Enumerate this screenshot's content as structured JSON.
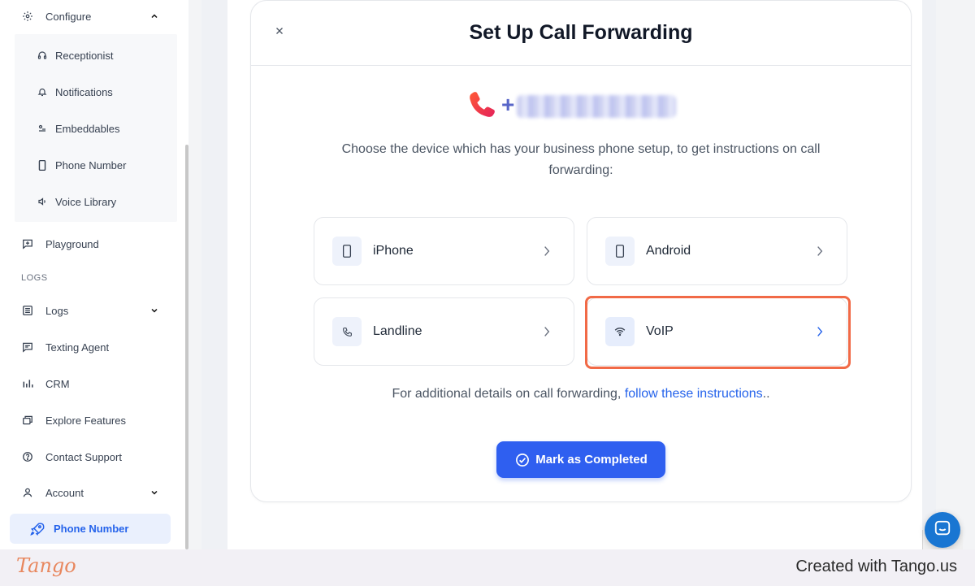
{
  "sidebar": {
    "configure_label": "Configure",
    "submenu": [
      {
        "label": "Receptionist",
        "icon": "headset-icon"
      },
      {
        "label": "Notifications",
        "icon": "bell-icon"
      },
      {
        "label": "Embeddables",
        "icon": "embed-icon"
      },
      {
        "label": "Phone Number",
        "icon": "mobile-icon"
      },
      {
        "label": "Voice Library",
        "icon": "speaker-icon"
      }
    ],
    "playground_label": "Playground",
    "logs_section": "LOGS",
    "items": [
      {
        "label": "Logs",
        "icon": "list-icon"
      },
      {
        "label": "Texting Agent",
        "icon": "message-icon"
      },
      {
        "label": "CRM",
        "icon": "bar-chart-icon"
      },
      {
        "label": "Explore Features",
        "icon": "layers-icon"
      },
      {
        "label": "Contact Support",
        "icon": "help-icon"
      },
      {
        "label": "Account",
        "icon": "user-icon"
      }
    ],
    "active_item": "Phone Number"
  },
  "modal": {
    "title": "Set Up Call Forwarding",
    "phone_prefix": "+",
    "instructions": "Choose the device which has your business phone setup, to get instructions on call forwarding:",
    "devices": [
      {
        "label": "iPhone",
        "icon": "mobile-icon"
      },
      {
        "label": "Android",
        "icon": "mobile-icon"
      },
      {
        "label": "Landline",
        "icon": "phone-icon"
      },
      {
        "label": "VoIP",
        "icon": "wifi-icon"
      }
    ],
    "selected_device": "VoIP",
    "footer_text": "For additional details on call forwarding, ",
    "footer_link": "follow these instructions",
    "footer_suffix": "..",
    "complete_button": "Mark as Completed"
  },
  "branding": {
    "logo": "Tango",
    "credit": "Created with Tango.us"
  },
  "colors": {
    "accent": "#2f5ff0",
    "highlight": "#f16a47",
    "phone_text": "#5866c8",
    "link": "#2563eb"
  }
}
